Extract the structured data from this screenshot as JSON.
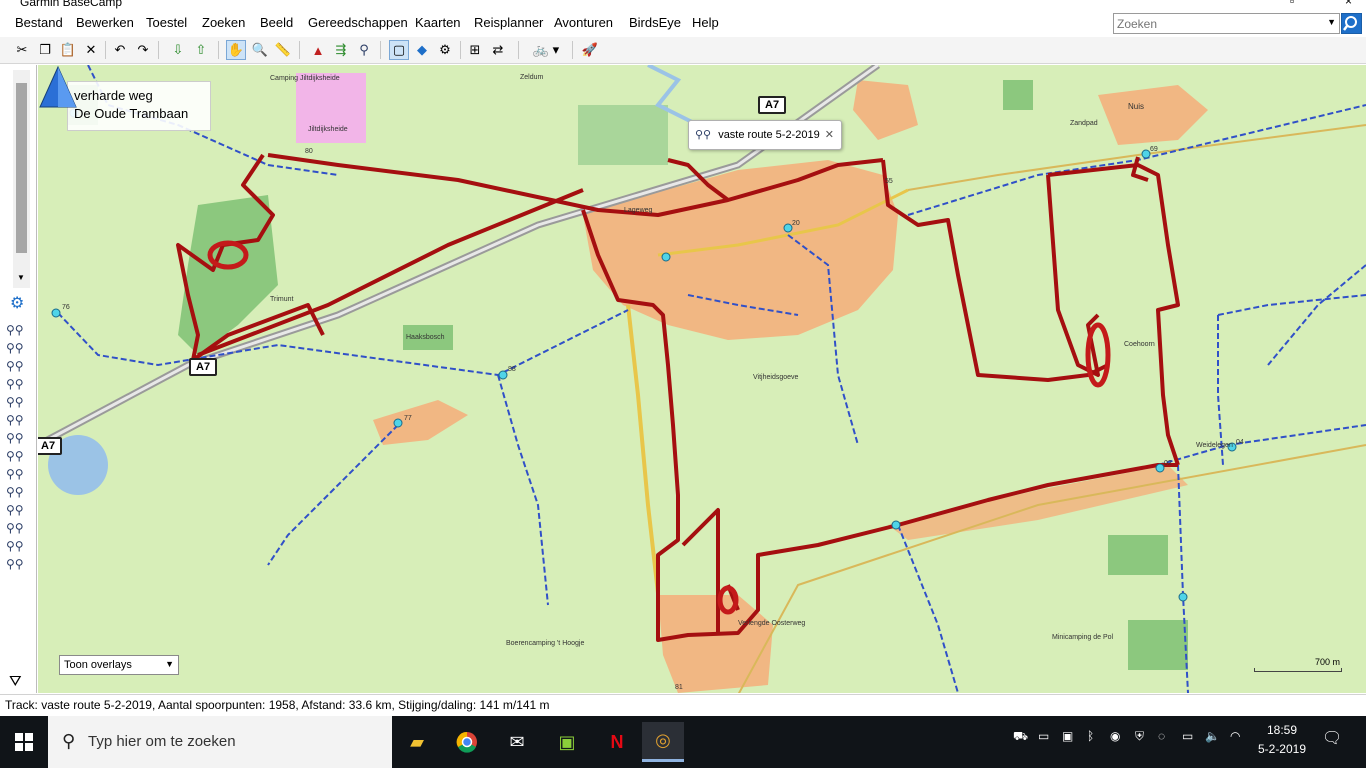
{
  "window": {
    "title": "Garmin BaseCamp"
  },
  "menu": [
    "Bestand",
    "Bewerken",
    "Toestel",
    "Zoeken",
    "Beeld",
    "Gereedschappen",
    "Kaarten",
    "Reisplanner",
    "Avonturen",
    "BirdsEye",
    "Help"
  ],
  "search": {
    "placeholder": "Zoeken"
  },
  "map": {
    "info": {
      "line1": "verharde weg",
      "line2": "De Oude Trambaan"
    },
    "tooltip": "vaste route 5-2-2019",
    "shields": [
      "A7",
      "A7",
      "A7"
    ],
    "overlays": "Toon overlays",
    "scale": "700 m",
    "labels": {
      "camping_jiltdijksheide": "Camping Jiltdijksheide",
      "jiltdijksheide": "Jiltdijksheide",
      "zeldum": "Zeldum",
      "lageweg": "Lageweg",
      "nuis": "Nuis",
      "zandpad": "Zandpad",
      "trimunt": "Trimunt",
      "haaksbosch": "Haaksbosch",
      "vitjheidsgoeve": "Vitjheidsgoeve",
      "coehoorn": "Coehoorn",
      "weidelegen": "Weidelegen",
      "boerencamping": "Boerencamping 't Hoogje",
      "verlengde_oosterweg": "Verlengde Oosterweg",
      "minicamping": "Minicamping de Pol",
      "km80": "80",
      "km76": "76",
      "km88": "88",
      "km77": "77",
      "km55": "55",
      "km20": "20",
      "km69": "69",
      "km04": "04",
      "km02": "02",
      "km81": "81"
    },
    "colors": {
      "background": "#d7eeb8",
      "builtup": "#f1b783",
      "forest": "#8cc87e",
      "track": "#a50f10",
      "road_yellow": "#e8c64a",
      "cycle_route": "#3050c8",
      "water": "#9bc3e6"
    }
  },
  "status": "Track: vaste route 5-2-2019, Aantal spoorpunten: 1958, Afstand: 33.6 km, Stijging/daling: 141 m/141 m",
  "taskbar": {
    "search_placeholder": "Typ hier om te zoeken",
    "time": "18:59",
    "date": "5-2-2019"
  }
}
